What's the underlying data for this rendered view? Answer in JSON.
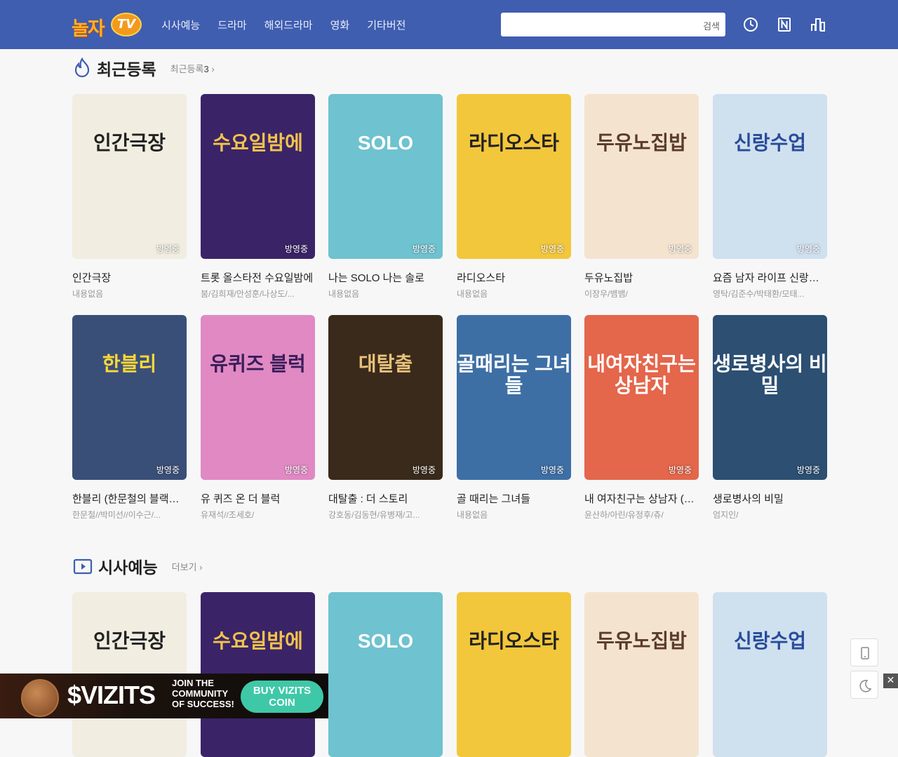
{
  "header": {
    "logo_text": "놀자",
    "logo_tv": "TV",
    "nav": [
      "시사예능",
      "드라마",
      "해외드라마",
      "영화",
      "기타버전"
    ],
    "search_placeholder": "",
    "search_button": "검색",
    "icons": [
      "clock-icon",
      "n-bookmark-icon",
      "ranking-icon"
    ]
  },
  "sections": [
    {
      "title": "최근등록",
      "more": "최근등록",
      "more_count": "3",
      "icon": "flame-icon",
      "items": [
        {
          "title": "인간극장",
          "sub": "내용없음",
          "badge": "방영중",
          "poster_text": "인간극장",
          "bg": "#f1ede1",
          "fg": "#222"
        },
        {
          "title": "트롯 올스타전 수요일밤에",
          "sub": "붐/김희재/안성훈/나상도/...",
          "badge": "방영중",
          "poster_text": "수요일밤에",
          "bg": "#3a2467",
          "fg": "#f3c34d"
        },
        {
          "title": "나는 SOLO 나는 솔로",
          "sub": "내용없음",
          "badge": "방영중",
          "poster_text": "SOLO",
          "bg": "#6fc2cf",
          "fg": "#ffffff"
        },
        {
          "title": "라디오스타",
          "sub": "내용없음",
          "badge": "방영중",
          "poster_text": "라디오스타",
          "bg": "#f3c73b",
          "fg": "#222"
        },
        {
          "title": "두유노집밥",
          "sub": "이장우/뱀뱀/",
          "badge": "방영중",
          "poster_text": "두유노집밥",
          "bg": "#f4e4cf",
          "fg": "#5b3b2a"
        },
        {
          "title": "요즘 남자 라이프 신랑수업",
          "sub": "영탁/김준수/박태환/모태...",
          "badge": "방영중",
          "poster_text": "신랑수업",
          "bg": "#cfe0ef",
          "fg": "#284c9a"
        },
        {
          "title": "한블리 (한문철의 블랙박스 리뷰)",
          "sub": "한문철//박미선//이수근/...",
          "badge": "방영중",
          "poster_text": "한블리",
          "bg": "#3a4f78",
          "fg": "#ffd83a"
        },
        {
          "title": "유 퀴즈 온 더 블럭",
          "sub": "유재석//조세호/",
          "badge": "방영중",
          "poster_text": "유퀴즈 블럭",
          "bg": "#e089c3",
          "fg": "#3a1d5a"
        },
        {
          "title": "대탈출 : 더 스토리",
          "sub": "강호동/김동현/유병재/고...",
          "badge": "방영중",
          "poster_text": "대탈출",
          "bg": "#3a2a1c",
          "fg": "#e7c27a"
        },
        {
          "title": "골 때리는 그녀들",
          "sub": "내용없음",
          "badge": "방영중",
          "poster_text": "골때리는 그녀들",
          "bg": "#3d6fa5",
          "fg": "#ffffff"
        },
        {
          "title": "내 여자친구는 상남자 (원작)",
          "sub": "윤산하/아린/유정후/츄/",
          "badge": "방영중",
          "poster_text": "내여자친구는 상남자",
          "bg": "#e4664b",
          "fg": "#ffffff"
        },
        {
          "title": "생로병사의 비밀",
          "sub": "엄지인/",
          "badge": "방영중",
          "poster_text": "생로병사의 비밀",
          "bg": "#2c4f72",
          "fg": "#ffffff"
        }
      ]
    },
    {
      "title": "시사예능",
      "more": "더보기",
      "icon": "play-icon",
      "items": [
        {
          "poster_text": "인간극장",
          "bg": "#f1ede1",
          "fg": "#222"
        },
        {
          "poster_text": "수요일밤에",
          "bg": "#3a2467",
          "fg": "#f3c34d"
        },
        {
          "poster_text": "SOLO",
          "bg": "#6fc2cf",
          "fg": "#ffffff"
        },
        {
          "poster_text": "라디오스타",
          "bg": "#f3c73b",
          "fg": "#222"
        },
        {
          "poster_text": "두유노집밥",
          "bg": "#f4e4cf",
          "fg": "#5b3b2a"
        },
        {
          "poster_text": "신랑수업",
          "bg": "#cfe0ef",
          "fg": "#284c9a"
        }
      ]
    }
  ],
  "ad": {
    "brand": "$VIZITS",
    "join": "JOIN THE COMMUNITY OF SUCCESS!",
    "buy": "BUY VIZITS COIN",
    "close": "✕"
  },
  "float_buttons": [
    "mobile-icon",
    "moon-icon"
  ]
}
